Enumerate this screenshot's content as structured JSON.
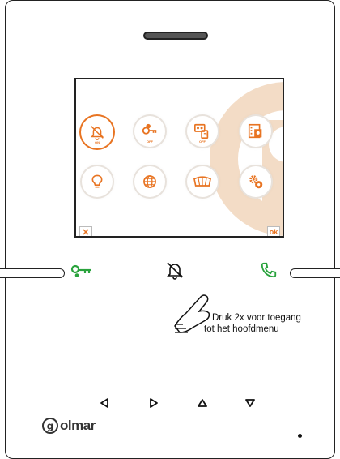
{
  "screen": {
    "icons_row1": [
      {
        "name": "do-not-disturb-icon",
        "sublabel": "ON"
      },
      {
        "name": "door-open-key-icon",
        "sublabel": "OFF"
      },
      {
        "name": "answering-machine-icon",
        "sublabel": "OFF"
      },
      {
        "name": "image-gallery-icon",
        "sublabel": ""
      }
    ],
    "icons_row2": [
      {
        "name": "light-bulb-icon"
      },
      {
        "name": "globe-icon"
      },
      {
        "name": "gate-barrier-icon"
      },
      {
        "name": "settings-gears-icon"
      }
    ],
    "cancel_label": "✕",
    "ok_label": "ok"
  },
  "hint": {
    "line1": "Druk 2x voor toegang",
    "line2": "tot het hoofdmenu"
  },
  "brand": {
    "letter": "g",
    "word": "olmar"
  },
  "colors": {
    "accent": "#e87422",
    "green": "#2aa33d",
    "watermark": "#f3dcc6"
  }
}
